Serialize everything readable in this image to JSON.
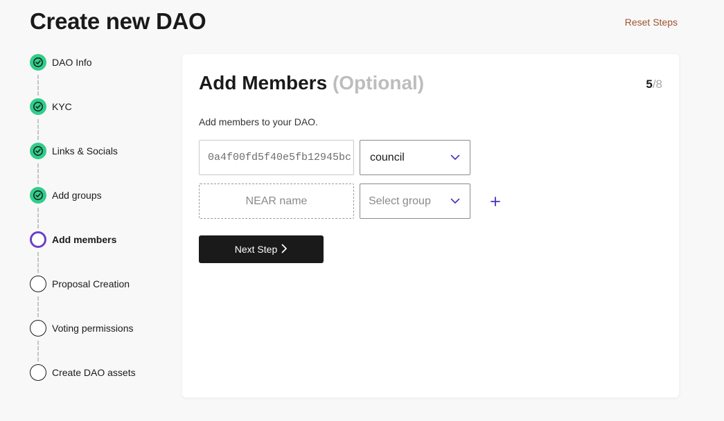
{
  "header": {
    "title": "Create new DAO",
    "reset_label": "Reset Steps"
  },
  "stepper": {
    "steps": [
      {
        "label": "DAO Info",
        "status": "done"
      },
      {
        "label": "KYC",
        "status": "done"
      },
      {
        "label": "Links & Socials",
        "status": "done"
      },
      {
        "label": "Add groups",
        "status": "done"
      },
      {
        "label": "Add members",
        "status": "current"
      },
      {
        "label": "Proposal Creation",
        "status": "todo"
      },
      {
        "label": "Voting permissions",
        "status": "todo"
      },
      {
        "label": "Create DAO assets",
        "status": "todo"
      }
    ]
  },
  "card": {
    "title": "Add Members",
    "title_optional": "(Optional)",
    "step_current": "5",
    "step_total": "/8",
    "description": "Add members to your DAO.",
    "members": [
      {
        "name_value": "0a4f00fd5f40e5fb12945bc",
        "group_value": "council"
      }
    ],
    "new_member": {
      "name_placeholder": "NEAR name",
      "group_placeholder": "Select group"
    },
    "next_label": "Next Step"
  },
  "colors": {
    "done": "#2fce8a",
    "current": "#6a3fc8",
    "accent": "#4a2fbd",
    "reset_link": "#a0522d"
  }
}
